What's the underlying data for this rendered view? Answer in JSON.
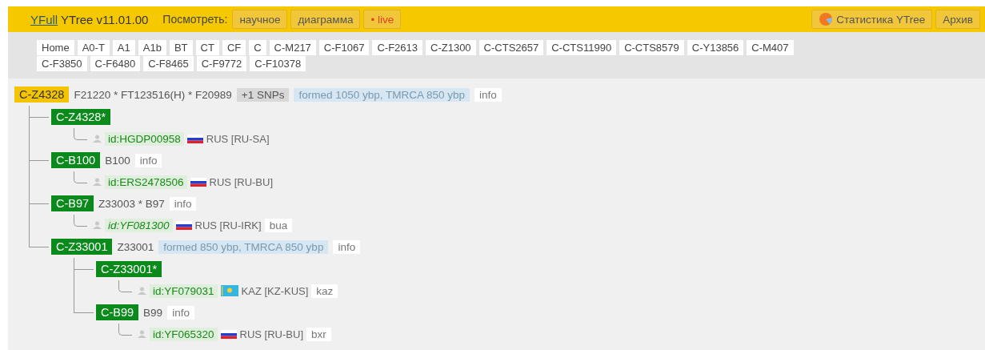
{
  "header": {
    "brand_link": "YFull",
    "title": "YTree v11.01.00",
    "view_label": "Посмотреть:",
    "view_buttons": [
      {
        "label": "научное",
        "kind": "plain"
      },
      {
        "label": "диаграмма",
        "kind": "plain"
      },
      {
        "label": "• live",
        "kind": "live"
      }
    ],
    "right_buttons": [
      {
        "label": "Статистика YTree",
        "kind": "stats"
      },
      {
        "label": "Архив",
        "kind": "plain"
      }
    ]
  },
  "tab_rows": [
    [
      "Home",
      "A0-T",
      "A1",
      "A1b",
      "BT",
      "CT",
      "CF",
      "C",
      "C-M217",
      "C-F1067",
      "C-F2613",
      "C-Z1300",
      "C-CTS2657",
      "C-CTS11990",
      "C-CTS8579",
      "C-Y13856",
      "C-M407"
    ],
    [
      "C-F3850",
      "C-F6480",
      "C-F8465",
      "C-F9772",
      "C-F10378"
    ]
  ],
  "tree": {
    "kind": "root",
    "name": "C-Z4328",
    "snps": "F21220 * FT123516(H) * F20989",
    "extra_snps": "+1 SNPs",
    "age": "formed 1050 ybp, TMRCA 850 ybp",
    "info": "info",
    "children": [
      {
        "kind": "clade",
        "name": "C-Z4328*",
        "children": [
          {
            "kind": "sample",
            "id": "id:HGDP00958",
            "italic": false,
            "flag": {
              "kind": "ru"
            },
            "location": "RUS [RU-SA]"
          }
        ]
      },
      {
        "kind": "clade",
        "name": "C-B100",
        "snps": "B100",
        "info": "info",
        "children": [
          {
            "kind": "sample",
            "id": "id:ERS2478506",
            "italic": false,
            "flag": {
              "kind": "ru"
            },
            "location": "RUS [RU-BU]"
          }
        ]
      },
      {
        "kind": "clade",
        "name": "C-B97",
        "snps": "Z33003 * B97",
        "info": "info",
        "children": [
          {
            "kind": "sample",
            "id": "id:YF081300",
            "italic": true,
            "flag": {
              "kind": "ru"
            },
            "location": "RUS [RU-IRK]",
            "lang": "bua"
          }
        ]
      },
      {
        "kind": "clade",
        "name": "C-Z33001",
        "snps": "Z33001",
        "age": "formed 850 ybp, TMRCA 850 ybp",
        "info": "info",
        "children": [
          {
            "kind": "clade",
            "name": "C-Z33001*",
            "children": [
              {
                "kind": "sample",
                "id": "id:YF079031",
                "italic": false,
                "flag": {
                  "kind": "kz"
                },
                "location": "KAZ [KZ-KUS]",
                "lang": "kaz"
              }
            ]
          },
          {
            "kind": "clade",
            "name": "C-B99",
            "snps": "B99",
            "info": "info",
            "children": [
              {
                "kind": "sample",
                "id": "id:YF065320",
                "italic": false,
                "flag": {
                  "kind": "ru"
                },
                "location": "RUS [RU-BU]",
                "lang": "bxr"
              }
            ]
          }
        ]
      }
    ]
  }
}
